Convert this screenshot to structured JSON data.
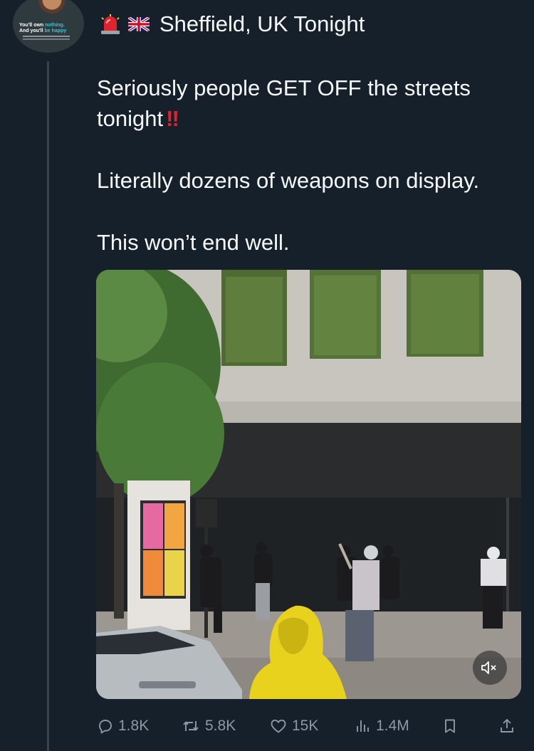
{
  "avatar": {
    "line1_a": "You'll own ",
    "line1_b": "nothing.",
    "line2_a": "And you'll ",
    "line2_b": "be happy"
  },
  "header": {
    "icons": [
      "siren-icon",
      "uk-flag-icon"
    ],
    "title": "Sheffield, UK Tonight"
  },
  "tweet": {
    "line1": "Seriously people GET OFF the streets",
    "line2": "tonight",
    "emphasis": "‼",
    "line3": "Literally dozens of weapons on display.",
    "line4": "This won’t end well."
  },
  "media": {
    "type": "video",
    "mute_icon": "speaker-muted-icon"
  },
  "actions": {
    "replies": "1.8K",
    "reposts": "5.8K",
    "likes": "15K",
    "views": "1.4M",
    "icons": [
      "reply-icon",
      "repost-icon",
      "like-icon",
      "views-icon",
      "bookmark-icon",
      "share-icon"
    ]
  },
  "colors": {
    "background": "#15202b",
    "text": "#f7f9f9",
    "muted": "#8b98a5",
    "thread_line": "#38444d",
    "alert_red": "#e0232e"
  }
}
